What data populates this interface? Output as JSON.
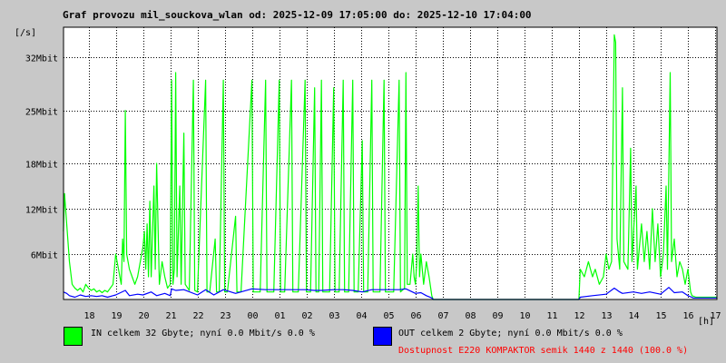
{
  "title": "Graf provozu mil_souckova_wlan od: 2025-12-09 17:05:00 do: 2025-12-10 17:04:00",
  "legend": {
    "in": {
      "text": "IN celkem 32 Gbyte; nyní    0.0 Mbit/s 0.0 %",
      "color": "#00ff00"
    },
    "out": {
      "text": "OUT celkem 2 Gbyte; nyní    0.0 Mbit/s 0.0 %",
      "color": "#0000ff"
    }
  },
  "availability": {
    "text": "Dostupnost E220 KOMPAKTOR semik 1440 z 1440 (100.0 %)",
    "color": "#ff0000"
  },
  "colors": {
    "background": "#c8c8c8",
    "plot_background": "#ffffff",
    "grid": "#000000"
  },
  "chart_data": {
    "type": "line",
    "yunit": "[/s]",
    "xunit": "[h]",
    "ylim": [
      0,
      36
    ],
    "xlim": [
      17.083,
      41.067
    ],
    "yticks": [
      {
        "value": 6,
        "label": "6Mbit"
      },
      {
        "value": 12,
        "label": "12Mbit"
      },
      {
        "value": 18,
        "label": "18Mbit"
      },
      {
        "value": 25,
        "label": "25Mbit"
      },
      {
        "value": 32,
        "label": "32Mbit"
      }
    ],
    "xticks": [
      {
        "value": 18,
        "label": "18"
      },
      {
        "value": 19,
        "label": "19"
      },
      {
        "value": 20,
        "label": "20"
      },
      {
        "value": 21,
        "label": "21"
      },
      {
        "value": 22,
        "label": "22"
      },
      {
        "value": 23,
        "label": "23"
      },
      {
        "value": 24,
        "label": "00"
      },
      {
        "value": 25,
        "label": "01"
      },
      {
        "value": 26,
        "label": "02"
      },
      {
        "value": 27,
        "label": "03"
      },
      {
        "value": 28,
        "label": "04"
      },
      {
        "value": 29,
        "label": "05"
      },
      {
        "value": 30,
        "label": "06"
      },
      {
        "value": 31,
        "label": "07"
      },
      {
        "value": 32,
        "label": "08"
      },
      {
        "value": 33,
        "label": "09"
      },
      {
        "value": 34,
        "label": "10"
      },
      {
        "value": 35,
        "label": "11"
      },
      {
        "value": 36,
        "label": "12"
      },
      {
        "value": 37,
        "label": "13"
      },
      {
        "value": 38,
        "label": "14"
      },
      {
        "value": 39,
        "label": "15"
      },
      {
        "value": 40,
        "label": "16"
      },
      {
        "value": 41,
        "label": "17"
      }
    ],
    "grid": true,
    "series": [
      {
        "name": "IN",
        "color": "#00ff00",
        "points": [
          [
            17.08,
            9
          ],
          [
            17.12,
            14
          ],
          [
            17.2,
            10
          ],
          [
            17.3,
            5
          ],
          [
            17.4,
            2
          ],
          [
            17.5,
            1.5
          ],
          [
            17.6,
            1.2
          ],
          [
            17.7,
            1.5
          ],
          [
            17.8,
            1
          ],
          [
            17.9,
            2
          ],
          [
            18.0,
            1.5
          ],
          [
            18.1,
            1.2
          ],
          [
            18.2,
            1.4
          ],
          [
            18.3,
            1
          ],
          [
            18.4,
            1.2
          ],
          [
            18.5,
            0.9
          ],
          [
            18.6,
            1.2
          ],
          [
            18.7,
            1
          ],
          [
            18.8,
            1.5
          ],
          [
            18.9,
            2
          ],
          [
            19.0,
            6
          ],
          [
            19.1,
            4
          ],
          [
            19.2,
            2
          ],
          [
            19.25,
            8
          ],
          [
            19.3,
            5
          ],
          [
            19.35,
            25
          ],
          [
            19.4,
            6
          ],
          [
            19.5,
            4
          ],
          [
            19.6,
            3
          ],
          [
            19.7,
            2
          ],
          [
            19.8,
            3
          ],
          [
            19.9,
            5
          ],
          [
            20.0,
            7
          ],
          [
            20.05,
            9
          ],
          [
            20.1,
            4
          ],
          [
            20.15,
            10
          ],
          [
            20.2,
            3
          ],
          [
            20.25,
            13
          ],
          [
            20.3,
            3
          ],
          [
            20.4,
            15
          ],
          [
            20.45,
            4
          ],
          [
            20.5,
            18
          ],
          [
            20.6,
            2
          ],
          [
            20.7,
            5
          ],
          [
            20.8,
            3
          ],
          [
            20.9,
            1.5
          ],
          [
            21.0,
            2
          ],
          [
            21.05,
            29
          ],
          [
            21.1,
            2
          ],
          [
            21.15,
            4
          ],
          [
            21.2,
            30
          ],
          [
            21.25,
            3
          ],
          [
            21.35,
            15
          ],
          [
            21.4,
            2
          ],
          [
            21.5,
            22
          ],
          [
            21.55,
            2
          ],
          [
            21.7,
            1.2
          ],
          [
            21.85,
            29
          ],
          [
            21.9,
            1.2
          ],
          [
            22.0,
            1
          ],
          [
            22.3,
            29
          ],
          [
            22.35,
            1
          ],
          [
            22.45,
            1
          ],
          [
            22.65,
            8
          ],
          [
            22.7,
            1
          ],
          [
            22.8,
            1
          ],
          [
            22.95,
            29
          ],
          [
            23.0,
            1
          ],
          [
            23.1,
            1
          ],
          [
            23.4,
            11
          ],
          [
            23.45,
            1
          ],
          [
            23.6,
            1
          ],
          [
            24.0,
            29
          ],
          [
            24.05,
            1
          ],
          [
            24.3,
            1
          ],
          [
            24.5,
            29
          ],
          [
            24.55,
            1
          ],
          [
            24.8,
            1
          ],
          [
            25.0,
            29
          ],
          [
            25.05,
            1
          ],
          [
            25.2,
            1
          ],
          [
            25.45,
            29
          ],
          [
            25.5,
            1
          ],
          [
            25.7,
            1
          ],
          [
            25.95,
            29
          ],
          [
            26.0,
            1
          ],
          [
            26.15,
            1
          ],
          [
            26.3,
            28
          ],
          [
            26.35,
            1
          ],
          [
            26.45,
            1
          ],
          [
            26.55,
            29
          ],
          [
            26.6,
            1
          ],
          [
            26.85,
            1
          ],
          [
            27.0,
            28
          ],
          [
            27.05,
            1
          ],
          [
            27.2,
            1
          ],
          [
            27.35,
            29
          ],
          [
            27.4,
            1
          ],
          [
            27.55,
            1
          ],
          [
            27.7,
            29
          ],
          [
            27.75,
            1
          ],
          [
            27.9,
            1
          ],
          [
            28.05,
            21
          ],
          [
            28.1,
            1
          ],
          [
            28.25,
            1
          ],
          [
            28.4,
            29
          ],
          [
            28.45,
            1
          ],
          [
            28.7,
            1
          ],
          [
            28.85,
            29
          ],
          [
            28.9,
            1
          ],
          [
            29.2,
            1
          ],
          [
            29.4,
            29
          ],
          [
            29.45,
            1
          ],
          [
            29.6,
            1.5
          ],
          [
            29.65,
            30
          ],
          [
            29.7,
            2
          ],
          [
            29.8,
            2
          ],
          [
            29.9,
            6
          ],
          [
            29.95,
            3
          ],
          [
            30.0,
            2
          ],
          [
            30.05,
            5
          ],
          [
            30.1,
            15
          ],
          [
            30.15,
            3
          ],
          [
            30.2,
            6
          ],
          [
            30.3,
            2
          ],
          [
            30.4,
            5
          ],
          [
            30.5,
            3
          ],
          [
            30.6,
            0.5
          ],
          [
            30.65,
            0
          ],
          [
            36.0,
            0
          ],
          [
            36.05,
            4
          ],
          [
            36.2,
            3
          ],
          [
            36.35,
            5
          ],
          [
            36.5,
            3
          ],
          [
            36.6,
            4
          ],
          [
            36.75,
            2
          ],
          [
            36.9,
            3
          ],
          [
            37.0,
            6
          ],
          [
            37.1,
            4
          ],
          [
            37.2,
            5
          ],
          [
            37.3,
            35
          ],
          [
            37.35,
            34
          ],
          [
            37.4,
            8
          ],
          [
            37.5,
            4
          ],
          [
            37.6,
            28
          ],
          [
            37.65,
            5
          ],
          [
            37.8,
            4
          ],
          [
            37.9,
            20
          ],
          [
            37.95,
            5
          ],
          [
            38.1,
            15
          ],
          [
            38.15,
            4
          ],
          [
            38.3,
            10
          ],
          [
            38.4,
            5
          ],
          [
            38.5,
            9
          ],
          [
            38.6,
            4
          ],
          [
            38.7,
            12
          ],
          [
            38.8,
            5
          ],
          [
            38.9,
            10
          ],
          [
            39.0,
            3
          ],
          [
            39.1,
            6
          ],
          [
            39.2,
            15
          ],
          [
            39.25,
            4
          ],
          [
            39.35,
            30
          ],
          [
            39.4,
            5
          ],
          [
            39.5,
            8
          ],
          [
            39.6,
            3
          ],
          [
            39.7,
            5
          ],
          [
            39.8,
            4
          ],
          [
            39.9,
            2
          ],
          [
            40.0,
            4
          ],
          [
            40.1,
            1
          ],
          [
            40.15,
            0.5
          ],
          [
            40.3,
            0.3
          ],
          [
            40.5,
            0.3
          ],
          [
            41.06,
            0.3
          ]
        ]
      },
      {
        "name": "OUT",
        "color": "#0000ff",
        "points": [
          [
            17.08,
            1
          ],
          [
            17.2,
            0.8
          ],
          [
            17.3,
            0.5
          ],
          [
            17.5,
            0.3
          ],
          [
            17.7,
            0.6
          ],
          [
            17.9,
            0.4
          ],
          [
            18.1,
            0.5
          ],
          [
            18.3,
            0.4
          ],
          [
            18.5,
            0.5
          ],
          [
            18.7,
            0.3
          ],
          [
            18.9,
            0.5
          ],
          [
            19.0,
            0.6
          ],
          [
            19.35,
            1.2
          ],
          [
            19.5,
            0.5
          ],
          [
            19.8,
            0.7
          ],
          [
            20.0,
            0.6
          ],
          [
            20.3,
            1
          ],
          [
            20.5,
            0.5
          ],
          [
            20.8,
            0.8
          ],
          [
            21.0,
            0.5
          ],
          [
            21.05,
            1.4
          ],
          [
            21.2,
            1.2
          ],
          [
            21.5,
            1.3
          ],
          [
            22.0,
            0.6
          ],
          [
            22.3,
            1.3
          ],
          [
            22.6,
            0.6
          ],
          [
            22.95,
            1.3
          ],
          [
            23.4,
            0.8
          ],
          [
            24.0,
            1.4
          ],
          [
            24.5,
            1.3
          ],
          [
            25.0,
            1.3
          ],
          [
            25.45,
            1.3
          ],
          [
            25.95,
            1.3
          ],
          [
            26.3,
            1.2
          ],
          [
            26.55,
            1.2
          ],
          [
            27.0,
            1.3
          ],
          [
            27.35,
            1.3
          ],
          [
            27.7,
            1.2
          ],
          [
            28.05,
            1
          ],
          [
            28.4,
            1.3
          ],
          [
            28.85,
            1.3
          ],
          [
            29.4,
            1.3
          ],
          [
            29.65,
            1.4
          ],
          [
            30.0,
            0.8
          ],
          [
            30.2,
            0.9
          ],
          [
            30.4,
            0.5
          ],
          [
            30.6,
            0.2
          ],
          [
            30.65,
            0
          ],
          [
            36.0,
            0
          ],
          [
            36.05,
            0.3
          ],
          [
            36.5,
            0.5
          ],
          [
            37.0,
            0.7
          ],
          [
            37.3,
            1.5
          ],
          [
            37.5,
            1
          ],
          [
            37.6,
            0.8
          ],
          [
            38.0,
            1
          ],
          [
            38.3,
            0.8
          ],
          [
            38.6,
            1
          ],
          [
            39.0,
            0.7
          ],
          [
            39.3,
            1.6
          ],
          [
            39.5,
            0.9
          ],
          [
            39.8,
            1
          ],
          [
            40.0,
            0.5
          ],
          [
            40.2,
            0.2
          ],
          [
            40.5,
            0.2
          ],
          [
            41.06,
            0.2
          ]
        ]
      }
    ]
  }
}
